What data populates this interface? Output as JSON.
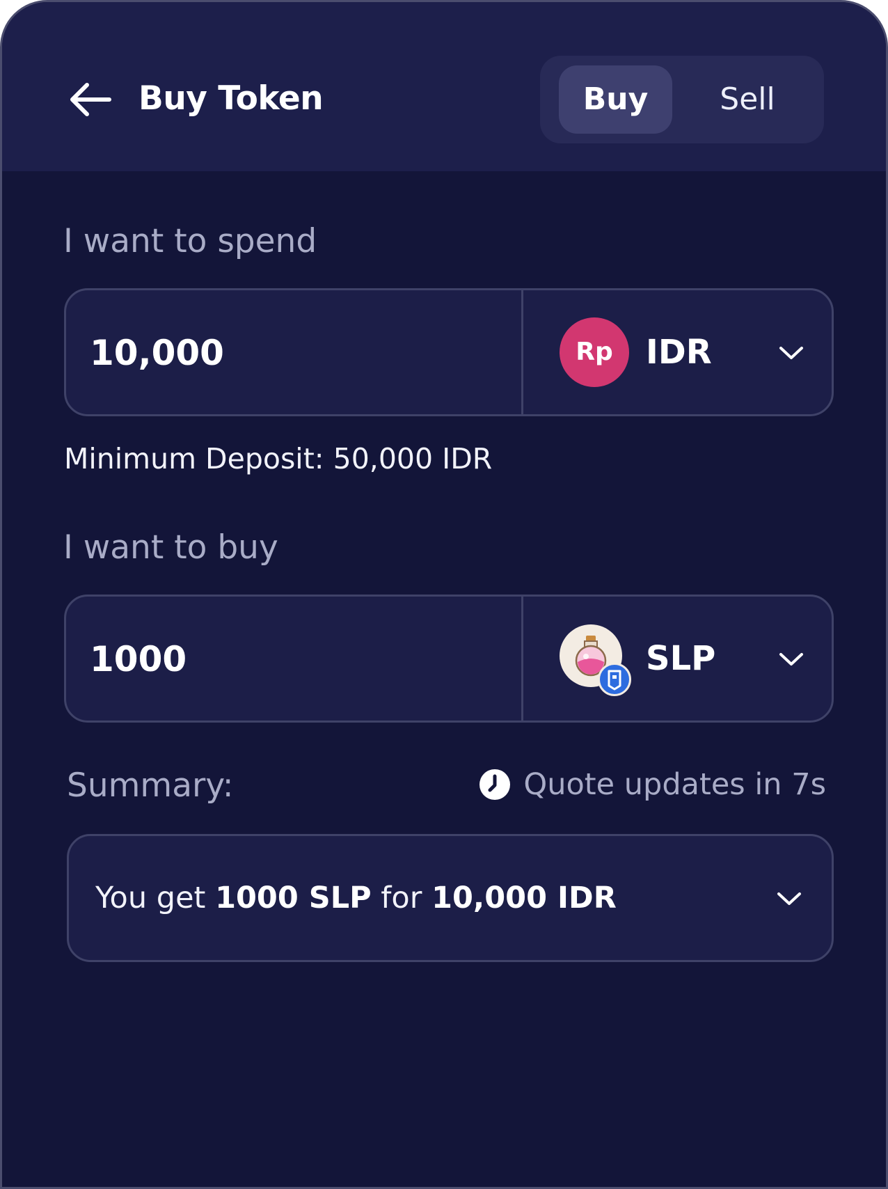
{
  "header": {
    "title": "Buy Token",
    "back_icon": "arrow-left-icon",
    "tabs": [
      {
        "label": "Buy",
        "active": true
      },
      {
        "label": "Sell",
        "active": false
      }
    ]
  },
  "spend": {
    "label": "I want to spend",
    "amount": "10,000",
    "currency_icon_text": "Rp",
    "currency": "IDR",
    "chevron_icon": "chevron-down-icon",
    "min_deposit": "Minimum Deposit: 50,000 IDR"
  },
  "buy": {
    "label": "I want to buy",
    "amount": "1000",
    "token_icon": "slp-potion-icon",
    "currency": "SLP",
    "chevron_icon": "chevron-down-icon"
  },
  "summary": {
    "label": "Summary:",
    "quote_icon": "clock-icon",
    "quote_text": "Quote updates in 7s",
    "prefix": "You get",
    "get_amount": "1000 SLP",
    "middle": "for",
    "pay_amount": "10,000 IDR",
    "chevron_icon": "chevron-down-icon"
  },
  "colors": {
    "background": "#131539",
    "header": "#1d1f4b",
    "field": "#1c1e48",
    "border": "#3f4268",
    "rp_badge": "#d23770",
    "muted_text": "#a9acc7"
  }
}
